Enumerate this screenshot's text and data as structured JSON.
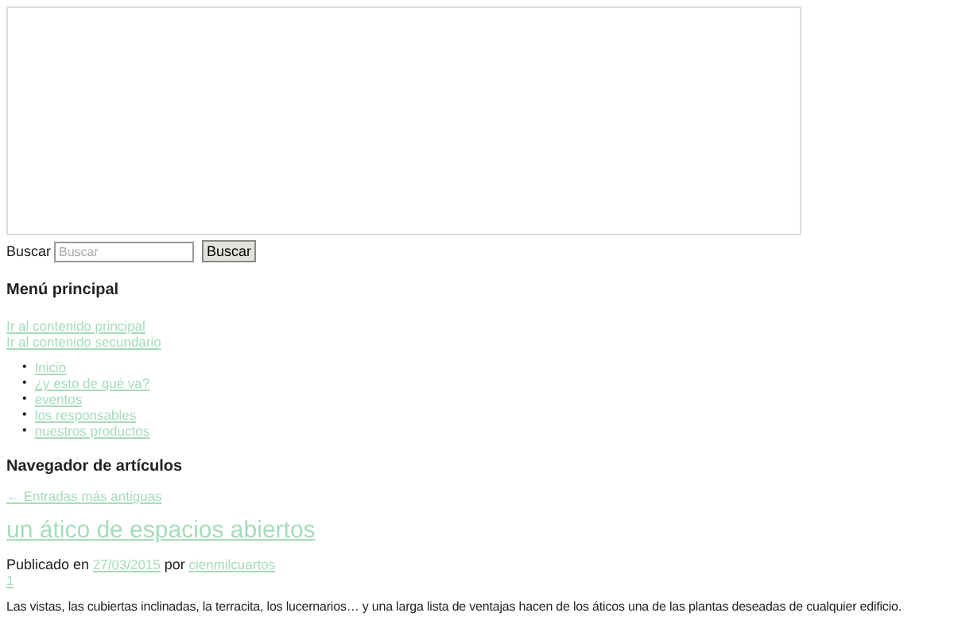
{
  "search": {
    "label": "Buscar",
    "placeholder": "Buscar",
    "button": "Buscar"
  },
  "menu": {
    "title": "Menú principal",
    "skip_links": [
      "Ir al contenido principal",
      "Ir al contenido secundario"
    ],
    "items": [
      {
        "marker": "•",
        "label": "Inicio"
      },
      {
        "marker": "•",
        "label": "¿y esto de qué va?"
      },
      {
        "marker": "•",
        "label": "eventos"
      },
      {
        "marker": "•",
        "label": "los responsables"
      },
      {
        "marker": "•",
        "label": "nuestros productos"
      }
    ]
  },
  "navigator": {
    "title": "Navegador de artículos",
    "older": "← Entradas más antiguas"
  },
  "post": {
    "title": "un ático de espacios abiertos",
    "published_prefix": "Publicado en",
    "date": "27/03/2015",
    "by": "por",
    "author": "cienmilcuartos",
    "comments": "1",
    "body": "Las vistas, las cubiertas inclinadas, la terracita, los lucernarios… y una larga lista de ventajas hacen de los áticos una de las plantas deseadas de cualquier edificio."
  }
}
